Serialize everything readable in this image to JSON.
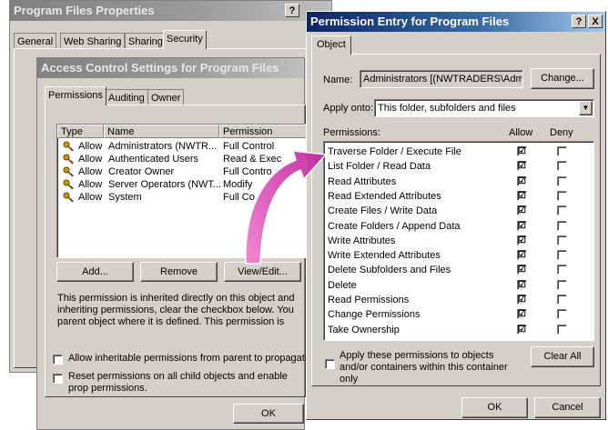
{
  "props_window": {
    "title": "Program Files Properties",
    "help_btn": "?",
    "tabs": [
      "General",
      "Web Sharing",
      "Sharing",
      "Security"
    ]
  },
  "acl_window": {
    "title": "Access Control Settings for Program Files",
    "tabs": [
      "Permissions",
      "Auditing",
      "Owner"
    ],
    "columns": [
      "Type",
      "Name",
      "Permission"
    ],
    "entries": [
      {
        "type": "Allow",
        "name": "Administrators (NWTR...",
        "permission": "Full Control"
      },
      {
        "type": "Allow",
        "name": "Authenticated Users",
        "permission": "Read & Exec"
      },
      {
        "type": "Allow",
        "name": "Creator Owner",
        "permission": "Full Contro"
      },
      {
        "type": "Allow",
        "name": "Server Operators (NWT...",
        "permission": "Modify"
      },
      {
        "type": "Allow",
        "name": "System",
        "permission": "Full Co"
      }
    ],
    "add_btn": "Add...",
    "remove_btn": "Remove",
    "view_edit_btn": "View/Edit...",
    "info_text": "This permission is inherited directly on this object and inheriting permissions, clear the checkbox below. You parent object where it is defined. This  permission is",
    "allow_inheritable": "Allow inheritable permissions from parent to propagate",
    "reset_perms": "Reset permissions on all child objects and enable prop permissions.",
    "ok_btn": "OK"
  },
  "perm_window": {
    "title": "Permission Entry for Program Files",
    "help_btn": "?",
    "close_btn": "X",
    "tab": "Object",
    "name_label": "Name:",
    "name_value": "Administrators [(NWTRADERS\\Admi",
    "change_btn": "Change...",
    "apply_label": "Apply onto:",
    "apply_value": "This folder, subfolders and files",
    "perm_header": "Permissions:",
    "allow_header": "Allow",
    "deny_header": "Deny",
    "permissions": [
      {
        "name": "Traverse Folder / Execute File",
        "allow": "☑",
        "deny": ""
      },
      {
        "name": "List Folder / Read Data",
        "allow": "☑",
        "deny": ""
      },
      {
        "name": "Read Attributes",
        "allow": "☑",
        "deny": ""
      },
      {
        "name": "Read Extended Attributes",
        "allow": "☑",
        "deny": ""
      },
      {
        "name": "Create Files / Write Data",
        "allow": "☑",
        "deny": ""
      },
      {
        "name": "Create Folders / Append Data",
        "allow": "☑",
        "deny": ""
      },
      {
        "name": "Write Attributes",
        "allow": "☑",
        "deny": ""
      },
      {
        "name": "Write Extended Attributes",
        "allow": "☑",
        "deny": ""
      },
      {
        "name": "Delete Subfolders and Files",
        "allow": "☑",
        "deny": ""
      },
      {
        "name": "Delete",
        "allow": "☑",
        "deny": ""
      },
      {
        "name": "Read Permissions",
        "allow": "☑",
        "deny": ""
      },
      {
        "name": "Change Permissions",
        "allow": "☑",
        "deny": ""
      },
      {
        "name": "Take Ownership",
        "allow": "☑",
        "deny": ""
      }
    ],
    "apply_containers": "Apply these permissions to objects and/or containers within this container only",
    "clear_all_btn": "Clear All",
    "ok_btn": "OK",
    "cancel_btn": "Cancel"
  },
  "colors": {
    "title_active": "#0a246a",
    "arrow": "#e040b0",
    "face": "#d4d0c8"
  }
}
